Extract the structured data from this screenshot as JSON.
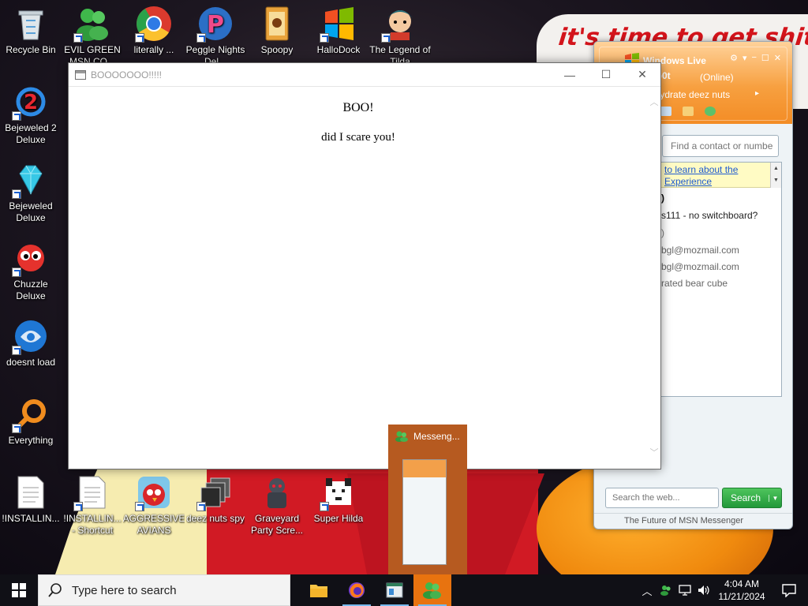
{
  "wallpaper": {
    "slogan": "it's time to get shit"
  },
  "desktop_icons": [
    {
      "label": "Recycle Bin"
    },
    {
      "label": "EVIL GREEN MSN CO..."
    },
    {
      "label": "literally ..."
    },
    {
      "label": "Peggle Nights Del..."
    },
    {
      "label": "Spoopy"
    },
    {
      "label": "HalloDock"
    },
    {
      "label": "The Legend of Tilda"
    },
    {
      "label": "Bejeweled 2 Deluxe"
    },
    {
      "label": "Bejeweled Deluxe"
    },
    {
      "label": "Chuzzle Deluxe"
    },
    {
      "label": "doesnt load"
    },
    {
      "label": "Everything"
    },
    {
      "label": "!INSTALLIN..."
    },
    {
      "label": "!INSTALLIN... - Shortcut"
    },
    {
      "label": "AGGRESSIVE AVIANS"
    },
    {
      "label": "deez nuts spy"
    },
    {
      "label": "Graveyard Party Scre..."
    },
    {
      "label": "Super Hilda"
    }
  ],
  "popup": {
    "title": "BOOOOOOO!!!!!",
    "heading": "BOO!",
    "body": "did I scare you!",
    "min_glyph": "—",
    "max_glyph": "☐",
    "close_glyph": "✕"
  },
  "messenger": {
    "title": "Windows Live",
    "name": "M0b0t",
    "status": "(Online)",
    "personal_message": "ehydrate deez nuts",
    "search_contact_placeholder": "Find a contact or numbe",
    "banner_line1": "to learn about the",
    "banner_line2": "Experience",
    "contacts": [
      ")",
      "s111 - no switchboard?",
      ")",
      "bgl@mozmail.com",
      "bgl@mozmail.com",
      "rated bear cube"
    ],
    "web_search_placeholder": "Search the web...",
    "web_search_button": "Search",
    "footer": "The Future of MSN Messenger",
    "accent_color": "#f39a35"
  },
  "thumbnail": {
    "label": "Messeng..."
  },
  "taskbar": {
    "search_placeholder": "Type here to search",
    "apps": [
      "file-explorer",
      "firefox",
      "window-app",
      "messenger"
    ],
    "time": "4:04 AM",
    "date": "11/21/2024"
  }
}
